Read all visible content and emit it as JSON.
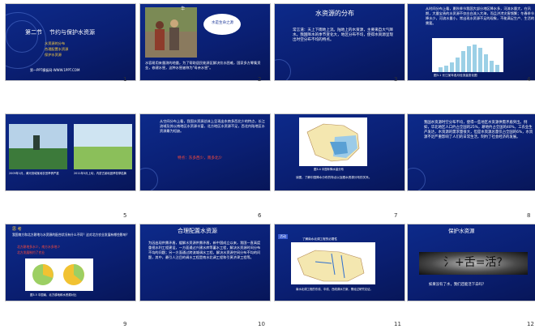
{
  "slides": [
    {
      "num": "1",
      "section": "第二节",
      "title": "节约与保护水资源",
      "bullets": [
        "水资源的分布",
        "合理配置水资源",
        "保护水资源"
      ],
      "footer": "第一PPT模板网-WWW.1PPT.COM"
    },
    {
      "num": "2",
      "badge": "华",
      "bubble": "水是生命之源",
      "caption": "水容易用来量测的地量，为了帮助居民能源区解决饮水困难，国家多方筹集资金，修建水窖，这种水窖被称为\"母亲水窖\"。"
    },
    {
      "num": "3",
      "title": "水资源的分布",
      "body": "常言道：天上下雨地上流。陆地上的水资源，主要来自大气降水。我国降水的季节变化大，地区分布不均，使得水资源呈现出时空分布不均的特点。"
    },
    {
      "num": "4",
      "body": "从时间分布上看，夏秋季节我国大部分地区降水多，河流水量大，在汛期，大量宝贵的水资源不仅白白流入大海，而且洪涝灾害频繁；冬春季节降水少，河流水量小，常出现水资源不足的现象，不能满足生产、生活的需要。",
      "chart_caption": "图3.1 长江某年各月径流量变化图"
    },
    {
      "num": "5",
      "cap_left": "2009年1月，黄河流域某地农田旱情严重",
      "cap_right": "2011年5月上旬，内蒙古某地因旱牧草枯黄"
    },
    {
      "num": "6",
      "body": "从空间分布上看，我国水资源总体上呈现出东南多西北少的特点，长江流域及其以南地区水资源丰富，北方地区水资源不足，西北内陆地区水资源最为短缺。",
      "sub": "特点：东多西少，南多北少"
    },
    {
      "num": "7",
      "map_caption": "图3.4 中国年降水量分布",
      "note": "读图，了解中国降水分布的特点以及跟水资源分布的关系。"
    },
    {
      "num": "8",
      "body": "我国水资源时空分布不均，使得一些地区水资源供需矛盾突出。例如，华北地区人口约占全国的25%，耕地约占全国的40%，工农业生产发达，水资源的需求量很大，但是水资源总量仅占全国的6%，水资源不足严重影响了人们的日常生活，制约了社会经济的发展。"
    },
    {
      "num": "9",
      "head": "思 考",
      "question": "我国南方和北方耕地与水资源的配合状况有什么不同？这对北方农业发展有哪些影响？",
      "answer1": "北方耕地多水少，南方水多地少",
      "answer2": "北方发展制约了农业",
      "chart_caption": "图3.5 中国南、北方耕地和水资源对比"
    },
    {
      "num": "10",
      "title": "合理配置水资源",
      "body": "为因出现供需矛盾，缓解水资源供需矛盾，新中国成立以来，我国一直高度重视水利工程建设，一方面通过兴建水库等蓄水工程，解决水资源时间分布不均的问题；另一方面通过跨流域调水工程，解决水资源空间分布不均的问题，其中，最引人注目的调水工程是南水北调工程和引黄济津工程等。"
    },
    {
      "num": "11",
      "tag": "活动",
      "map_title": "了解南水北调工程的必要性",
      "note1": "南水北调工程的东线、中线、西线调水方案，需经过研究论证。"
    },
    {
      "num": "12",
      "title": "保护水资源",
      "formula": "氵+舌=活?",
      "question": "如果没有了水，我们还能活下去吗？"
    }
  ],
  "colors": {
    "slide_bg": "#0d2a8a",
    "title": "#ffd23f",
    "highlight": "#ff4b3a"
  }
}
